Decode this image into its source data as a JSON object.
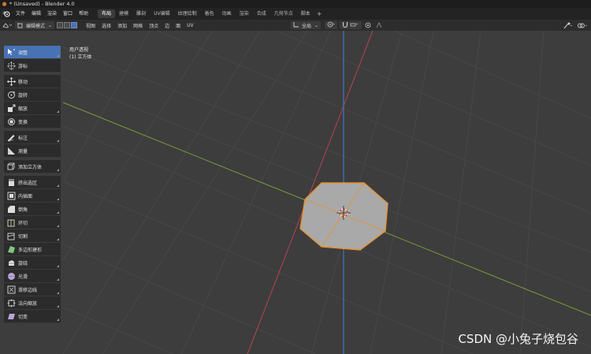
{
  "window": {
    "title": "* (Unsaved) - Blender 4.0"
  },
  "menubar": {
    "items": [
      "文件",
      "编辑",
      "渲染",
      "窗口",
      "帮助"
    ],
    "workspaces": [
      "布局",
      "建模",
      "雕刻",
      "UV编辑",
      "纹理绘制",
      "着色",
      "动画",
      "渲染",
      "合成",
      "几何节点",
      "脚本"
    ],
    "active_workspace": "布局",
    "add_symbol": "+"
  },
  "viewport_header": {
    "mode": "编辑模式",
    "menus": [
      "视图",
      "选择",
      "添加",
      "网格",
      "顶点",
      "边",
      "面",
      "UV"
    ],
    "transform_orientation": "全局"
  },
  "overlay": {
    "view_name": "用户透视",
    "object_name": "(1) 立方体"
  },
  "toolbar": {
    "tools": [
      {
        "label": "调整",
        "icon": "tweak-icon",
        "active": true,
        "corner": true
      },
      {
        "label": "游标",
        "icon": "cursor-icon",
        "active": false,
        "corner": false
      },
      {
        "gap": true
      },
      {
        "label": "移动",
        "icon": "move-icon",
        "active": false,
        "corner": false
      },
      {
        "label": "旋转",
        "icon": "rotate-icon",
        "active": false,
        "corner": false
      },
      {
        "label": "缩放",
        "icon": "scale-icon",
        "active": false,
        "corner": true
      },
      {
        "label": "变换",
        "icon": "transform-icon",
        "active": false,
        "corner": false
      },
      {
        "gap": true
      },
      {
        "label": "标注",
        "icon": "annotate-icon",
        "active": false,
        "corner": true
      },
      {
        "label": "测量",
        "icon": "measure-icon",
        "active": false,
        "corner": false
      },
      {
        "gap": true
      },
      {
        "label": "添加立方体",
        "icon": "add-cube-icon",
        "active": false,
        "corner": true
      },
      {
        "gap": true
      },
      {
        "label": "挤出选区",
        "icon": "extrude-icon",
        "active": false,
        "corner": true
      },
      {
        "label": "内插面",
        "icon": "inset-icon",
        "active": false,
        "corner": true
      },
      {
        "label": "倒角",
        "icon": "bevel-icon",
        "active": false,
        "corner": true
      },
      {
        "label": "环切",
        "icon": "loop-cut-icon",
        "active": false,
        "corner": true
      },
      {
        "label": "切割",
        "icon": "knife-icon",
        "active": false,
        "corner": true
      },
      {
        "label": "多边形建形",
        "icon": "poly-build-icon",
        "active": false,
        "corner": false
      },
      {
        "label": "旋绕",
        "icon": "spin-icon",
        "active": false,
        "corner": true
      },
      {
        "label": "光滑",
        "icon": "smooth-icon",
        "active": false,
        "corner": true
      },
      {
        "label": "滑移边线",
        "icon": "edge-slide-icon",
        "active": false,
        "corner": true
      },
      {
        "label": "法向缩放",
        "icon": "shrink-fatten-icon",
        "active": false,
        "corner": true
      },
      {
        "label": "切变",
        "icon": "shear-icon",
        "active": false,
        "corner": true
      }
    ]
  },
  "colors": {
    "active_tool": "#4772b3",
    "axis_x": "#b8434f",
    "axis_y": "#7a9a3a",
    "axis_z": "#3f6bb0",
    "selection": "#e8922e"
  },
  "watermark": "CSDN @小兔子烧包谷"
}
